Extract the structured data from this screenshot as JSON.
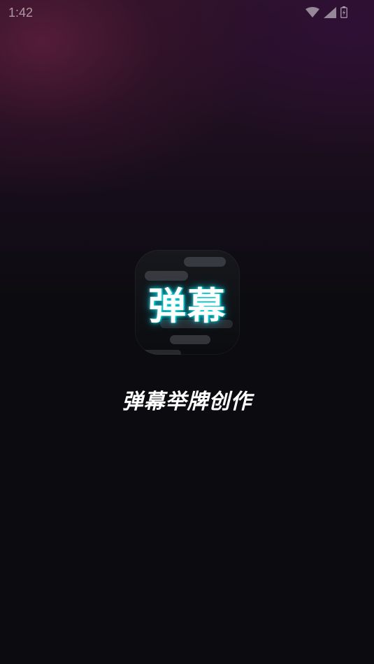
{
  "status_bar": {
    "time": "1:42",
    "icons": [
      "wifi-icon",
      "cell-signal-icon",
      "battery-icon"
    ]
  },
  "splash": {
    "icon_text": "弹幕",
    "app_name": "弹幕举牌创作"
  },
  "colors": {
    "background": "#0c0c10",
    "glow": "#00e6e6",
    "text": "#ffffff"
  }
}
